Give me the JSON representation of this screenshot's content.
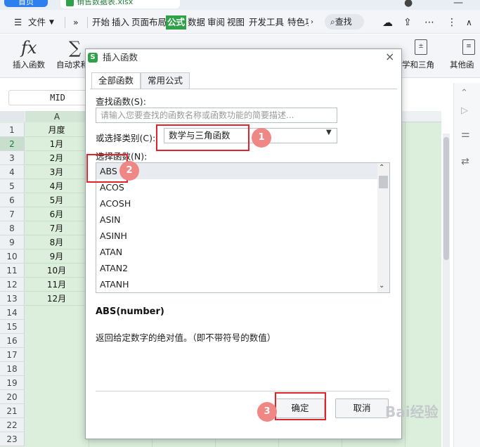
{
  "app": {
    "home_tab": "首页",
    "file_tab": "销售数据表.xlsx"
  },
  "menu": {
    "items": [
      "文件",
      "开始",
      "插入",
      "页面布局",
      "公式",
      "数据",
      "审阅",
      "视图",
      "开发工具",
      "特色功"
    ],
    "active": "公式",
    "search_label": "查找",
    "more": "»"
  },
  "ribbon": {
    "insert_function": "插入函数",
    "autosum": "自动求和",
    "math_trig": "学和三角",
    "other": "其他函"
  },
  "formula_bar": {
    "name_box": "MID"
  },
  "sheet": {
    "column_a": "A",
    "rows": [
      "1",
      "2",
      "3",
      "4",
      "5",
      "6",
      "7",
      "8",
      "9",
      "10",
      "11",
      "12",
      "13",
      "14",
      "15",
      "16",
      "17",
      "18",
      "19",
      "20",
      "21",
      "22",
      "23"
    ],
    "col_a_values": [
      "月度",
      "1月",
      "2月",
      "3月",
      "4月",
      "5月",
      "6月",
      "7月",
      "8月",
      "9月",
      "10月",
      "11月",
      "12月"
    ]
  },
  "dialog": {
    "title": "插入函数",
    "close": "×",
    "tabs": [
      "全部函数",
      "常用公式"
    ],
    "search_label": "查找函数(S):",
    "search_placeholder": "请输入您要查找的函数名称或函数功能的简要描述...",
    "category_label": "或选择类别(C):",
    "category_value": "数学与三角函数",
    "function_label": "选择函数(N):",
    "functions": [
      "ABS",
      "ACOS",
      "ACOSH",
      "ASIN",
      "ASINH",
      "ATAN",
      "ATAN2",
      "ATANH"
    ],
    "selected_function": "ABS",
    "signature": "ABS(number)",
    "description": "返回给定数字的绝对值。（即不带符号的数值）",
    "ok": "确定",
    "cancel": "取消"
  },
  "annotations": {
    "markers": [
      "1",
      "2",
      "3"
    ],
    "color": "#e0242b"
  },
  "watermark": "Bai经验"
}
